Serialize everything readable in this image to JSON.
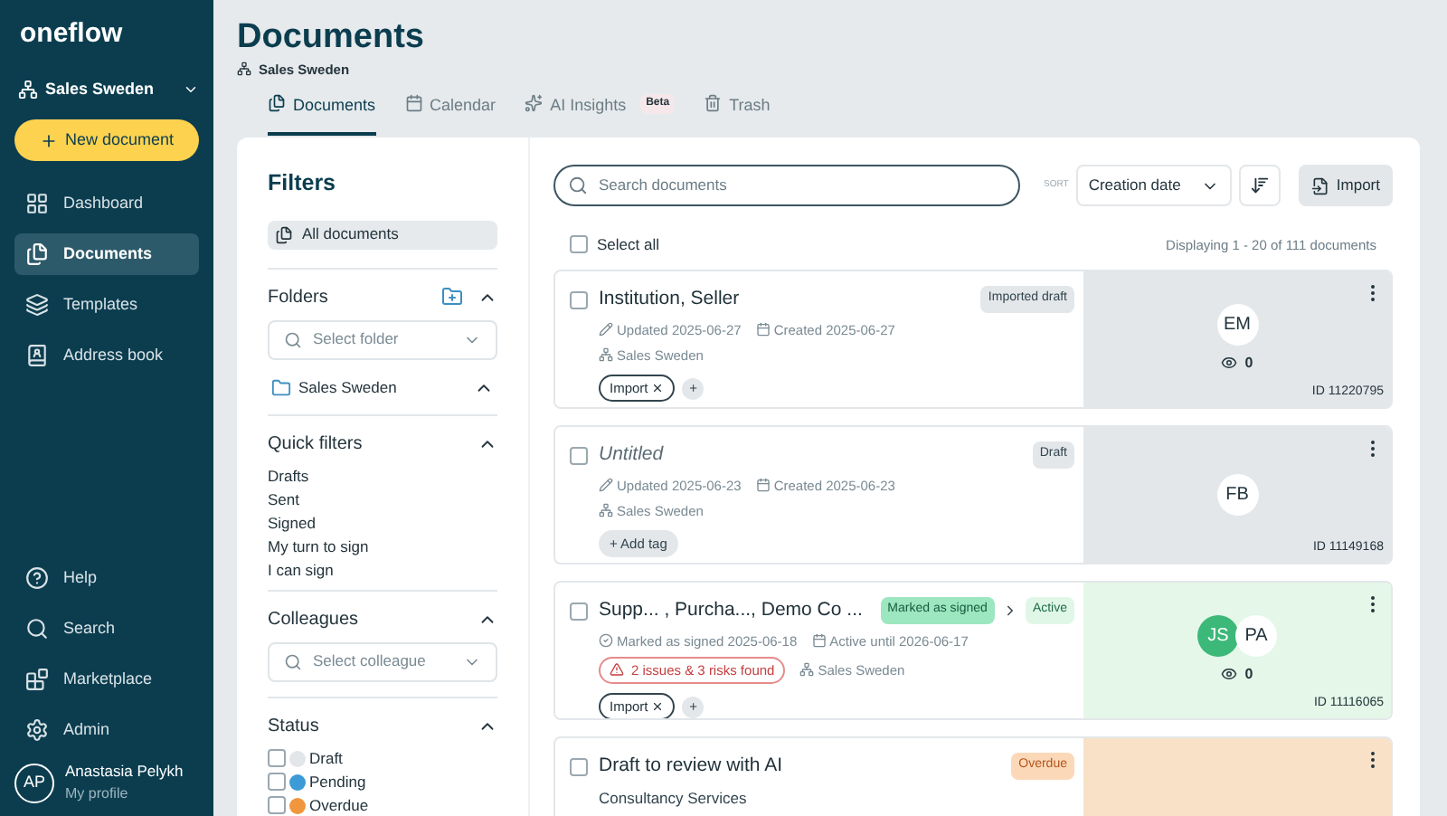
{
  "sidebar": {
    "logo": "oneflow",
    "workspace": "Sales Sweden",
    "new_document": "New document",
    "items": [
      {
        "label": "Dashboard",
        "selected": false
      },
      {
        "label": "Documents",
        "selected": true
      },
      {
        "label": "Templates",
        "selected": false
      },
      {
        "label": "Address book",
        "selected": false
      }
    ],
    "bottom_items": [
      {
        "label": "Help"
      },
      {
        "label": "Search"
      },
      {
        "label": "Marketplace"
      },
      {
        "label": "Admin"
      }
    ],
    "profile": {
      "initials": "AP",
      "name": "Anastasia Pelykh",
      "subtitle": "My profile"
    }
  },
  "header": {
    "title": "Documents",
    "workspace": "Sales Sweden",
    "tabs": [
      {
        "label": "Documents",
        "selected": true
      },
      {
        "label": "Calendar",
        "selected": false
      },
      {
        "label": "AI Insights",
        "badge": "Beta",
        "selected": false
      },
      {
        "label": "Trash",
        "selected": false
      }
    ]
  },
  "filters": {
    "title": "Filters",
    "all_documents": "All documents",
    "folders": {
      "title": "Folders",
      "expanded": true,
      "placeholder": "Select folder",
      "items": [
        {
          "label": "Sales Sweden",
          "expanded": true
        }
      ]
    },
    "quick_filters": {
      "title": "Quick filters",
      "expanded": true,
      "items": [
        "Drafts",
        "Sent",
        "Signed",
        "My turn to sign",
        "I can sign"
      ]
    },
    "colleagues": {
      "title": "Colleagues",
      "expanded": true,
      "placeholder": "Select colleague"
    },
    "status": {
      "title": "Status",
      "expanded": true,
      "items": [
        {
          "label": "Draft",
          "checked": false,
          "color": "#e3e6e9"
        },
        {
          "label": "Pending",
          "checked": false,
          "color": "#3c9ad6"
        },
        {
          "label": "Overdue",
          "checked": false,
          "color": "#f0963c"
        }
      ]
    }
  },
  "toolbar": {
    "search_placeholder": "Search documents",
    "sort_label": "SORT",
    "sort_value": "Creation date",
    "import": "Import",
    "select_all": "Select all",
    "select_all_checked": false,
    "count": "Displaying 1 - 20 of 111 documents"
  },
  "documents": [
    {
      "title": "Institution, Seller",
      "italic": false,
      "checked": false,
      "kind": "draft",
      "badges": [
        {
          "label": "Imported draft",
          "kind": "gray"
        }
      ],
      "meta": [
        {
          "kind": "updated",
          "text": "Updated 2025-06-27"
        },
        {
          "kind": "date",
          "text": "Created 2025-06-27"
        }
      ],
      "workspace": "Sales Sweden",
      "tags": [
        "Import"
      ],
      "add_tag": "+",
      "participants": [
        {
          "initials": "EM",
          "signed": false
        }
      ],
      "views": "0",
      "id": "ID 11220795"
    },
    {
      "title": "Untitled",
      "italic": true,
      "checked": false,
      "kind": "draft",
      "badges": [
        {
          "label": "Draft",
          "kind": "gray"
        }
      ],
      "meta": [
        {
          "kind": "updated",
          "text": "Updated 2025-06-23"
        },
        {
          "kind": "date",
          "text": "Created 2025-06-23"
        }
      ],
      "workspace": "Sales Sweden",
      "add_tag": "+ Add tag",
      "participants": [
        {
          "initials": "FB",
          "signed": false
        }
      ],
      "id": "ID 11149168"
    },
    {
      "title": "Supp... , Purcha..., Demo Co ...",
      "italic": false,
      "checked": false,
      "kind": "active",
      "badges": [
        {
          "label": "Marked as signed",
          "kind": "green"
        },
        {
          "label": "Active",
          "kind": "lightgreen"
        }
      ],
      "meta": [
        {
          "kind": "signed",
          "text": "Marked as signed 2025-06-18"
        },
        {
          "kind": "date",
          "text": "Active until 2026-06-17"
        }
      ],
      "warning": "2 issues & 3 risks found",
      "workspace": "Sales Sweden",
      "tags": [
        "Import"
      ],
      "add_tag": "+",
      "participants": [
        {
          "initials": "JS",
          "signed": true
        },
        {
          "initials": "PA",
          "signed": false
        }
      ],
      "views": "0",
      "id": "ID 11116065"
    },
    {
      "title": "Draft to review with AI",
      "italic": false,
      "checked": false,
      "kind": "overdue",
      "badges": [
        {
          "label": "Overdue",
          "kind": "orange"
        }
      ],
      "subtitle": "Consultancy Services"
    }
  ]
}
